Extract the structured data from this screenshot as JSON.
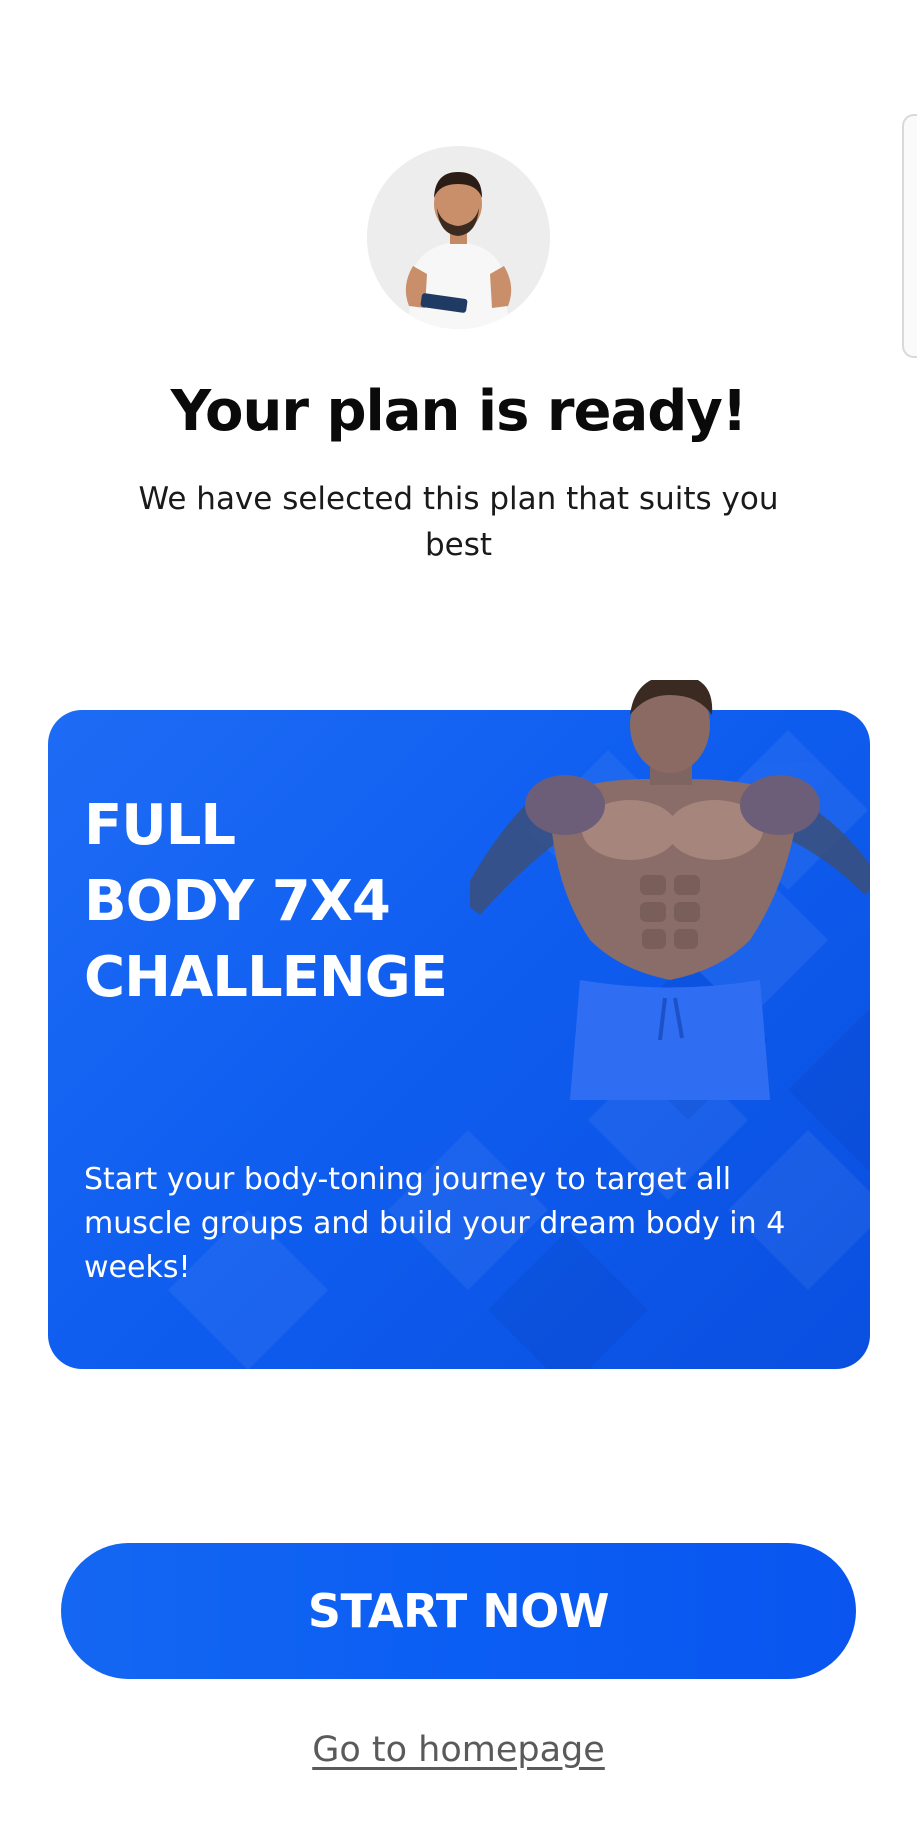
{
  "header": {
    "title": "Your plan is ready!",
    "subtitle": "We have selected this plan that suits you best"
  },
  "plan": {
    "title_lines": [
      "FULL",
      "BODY 7X4",
      "CHALLENGE"
    ],
    "description": "Start your body-toning journey to target all muscle groups and build your dream body in 4 weeks!",
    "accent_color": "#0f5ef0"
  },
  "actions": {
    "start_label": "START NOW",
    "home_label": "Go to homepage"
  },
  "icons": {
    "avatar": "trainer-avatar",
    "hero": "athlete-image"
  }
}
